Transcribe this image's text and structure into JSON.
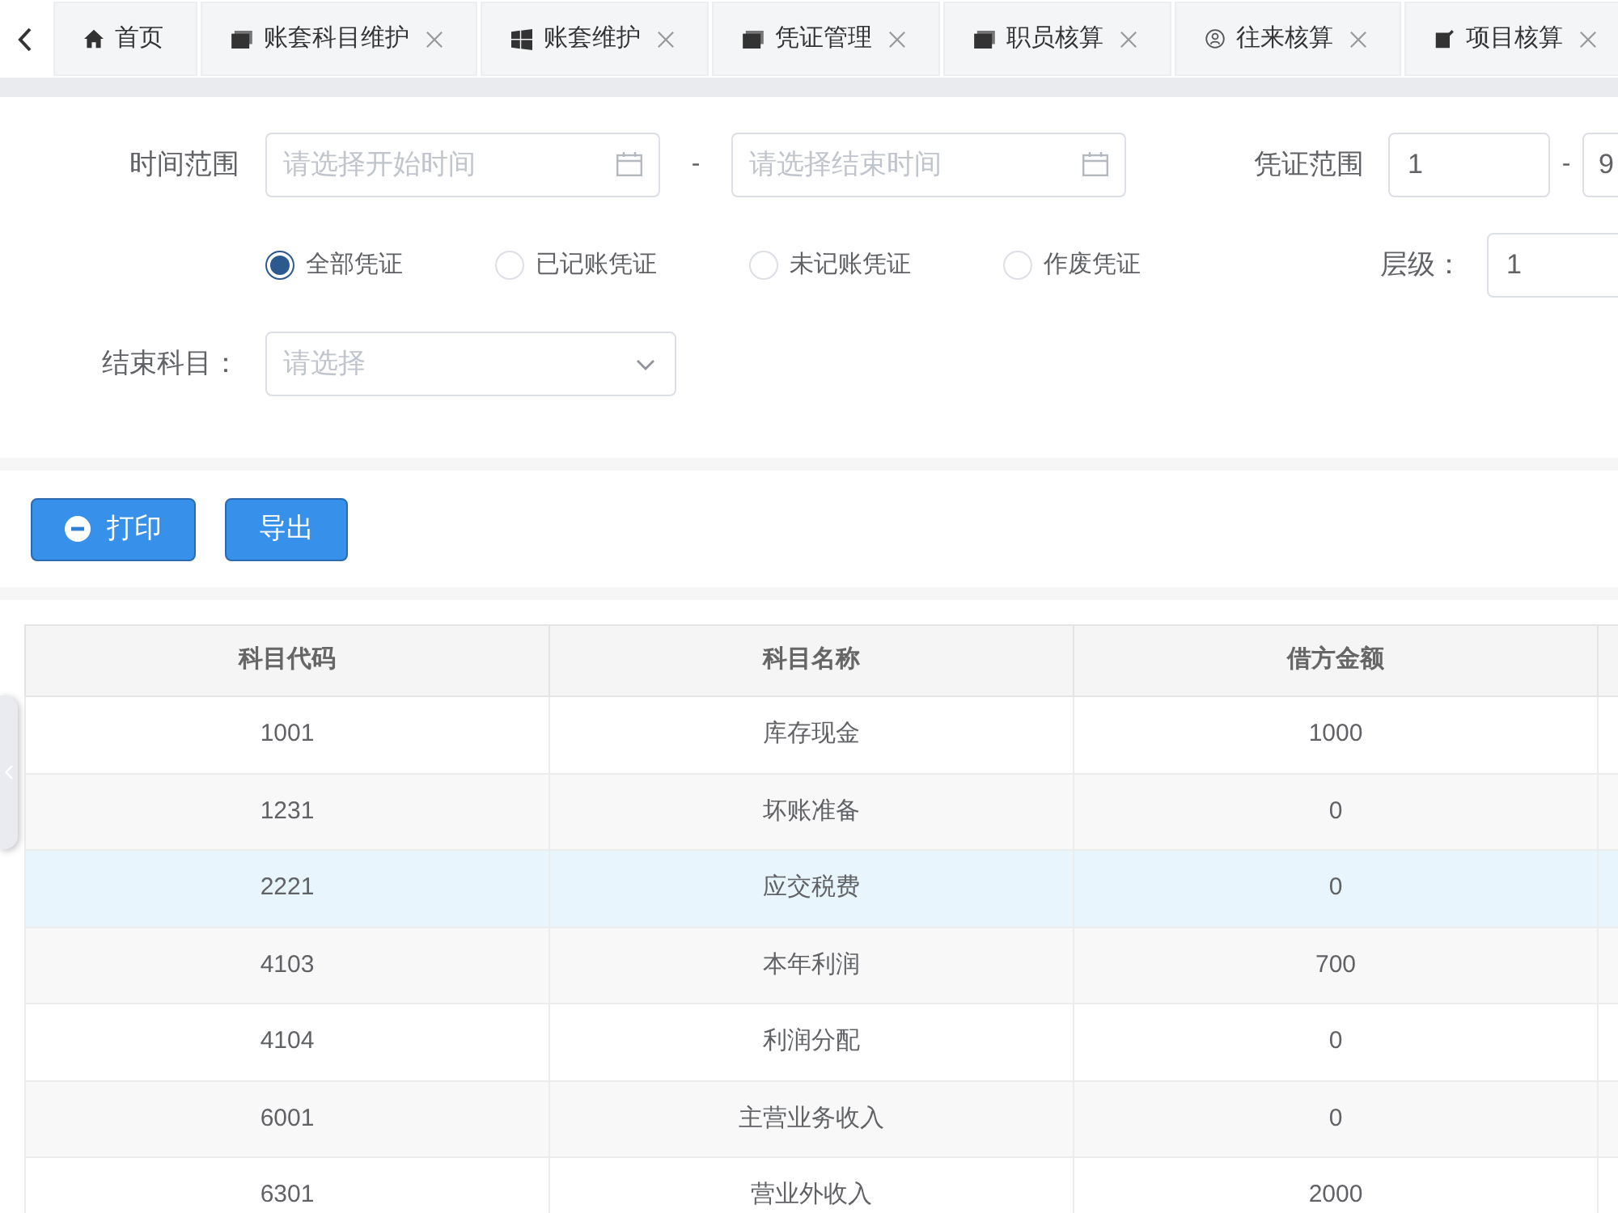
{
  "tab_bar": {
    "tabs": [
      {
        "label": "首页",
        "kind": "home",
        "closable": false
      },
      {
        "label": "账套科目维护",
        "kind": "card",
        "closable": true
      },
      {
        "label": "账套维护",
        "kind": "grid",
        "closable": true
      },
      {
        "label": "凭证管理",
        "kind": "card",
        "closable": true
      },
      {
        "label": "职员核算",
        "kind": "card",
        "closable": true
      },
      {
        "label": "往来核算",
        "kind": "user",
        "closable": true
      },
      {
        "label": "项目核算",
        "kind": "edit",
        "closable": true
      }
    ]
  },
  "filters": {
    "time_range": {
      "label": "时间范围",
      "start_placeholder": "请选择开始时间",
      "separator": "-",
      "end_placeholder": "请选择结束时间"
    },
    "voucher_range": {
      "label": "凭证范围",
      "from": "1",
      "separator": "-",
      "to": "9"
    },
    "voucher_status": [
      {
        "label": "全部凭证",
        "selected": true
      },
      {
        "label": "已记账凭证",
        "selected": false
      },
      {
        "label": "未记账凭证",
        "selected": false
      },
      {
        "label": "作废凭证",
        "selected": false
      }
    ],
    "level": {
      "label": "层级：",
      "value": "1"
    },
    "end_account": {
      "label": "结束科目：",
      "placeholder": "请选择"
    }
  },
  "actions": [
    {
      "label": "打印",
      "kind": "icon"
    },
    {
      "label": "导出",
      "kind": "text"
    }
  ],
  "table": {
    "columns": [
      "科目代码",
      "科目名称",
      "借方金额"
    ],
    "rows": [
      {
        "cells": [
          "1001",
          "库存现金",
          "1000"
        ],
        "selected": false
      },
      {
        "cells": [
          "1231",
          "坏账准备",
          "0"
        ],
        "selected": false
      },
      {
        "cells": [
          "2221",
          "应交税费",
          "0"
        ],
        "selected": true
      },
      {
        "cells": [
          "4103",
          "本年利润",
          "700"
        ],
        "selected": false
      },
      {
        "cells": [
          "4104",
          "利润分配",
          "0"
        ],
        "selected": false
      },
      {
        "cells": [
          "6001",
          "主营业务收入",
          "0"
        ],
        "selected": false
      },
      {
        "cells": [
          "6301",
          "营业外收入",
          "2000"
        ],
        "selected": false
      }
    ]
  }
}
